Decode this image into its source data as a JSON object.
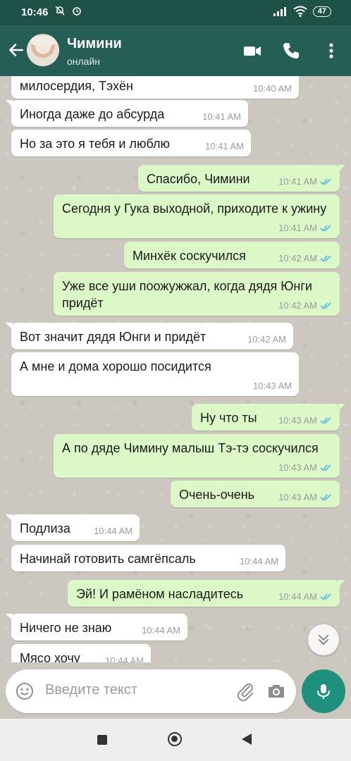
{
  "status_bar": {
    "time": "10:46",
    "battery": "47"
  },
  "header": {
    "contact_name": "Чимини",
    "contact_status": "онлайн"
  },
  "messages": [
    {
      "dir": "in",
      "text": "милосердия, Тэхён",
      "time": "10:40 AM"
    },
    {
      "dir": "in",
      "text": "Иногда даже до абсурда",
      "time": "10:41 AM"
    },
    {
      "dir": "in",
      "text": "Но за это я тебя и люблю",
      "time": "10:41 AM"
    },
    {
      "dir": "out",
      "text": "Спасибо, Чимини",
      "time": "10:41 AM"
    },
    {
      "dir": "out",
      "text": "Сегодня у Гука выходной, приходите к ужину",
      "time": "10:41 AM"
    },
    {
      "dir": "out",
      "text": "Минхёк соскучился",
      "time": "10:42 AM"
    },
    {
      "dir": "out",
      "text": "Уже все уши поожужжал, когда дядя Юнги придёт",
      "time": "10:42 AM"
    },
    {
      "dir": "in",
      "text": "Вот значит дядя Юнги и придёт",
      "time": "10:42 AM"
    },
    {
      "dir": "in",
      "text": "А мне и дома хорошо посидится",
      "time": "10:43 AM"
    },
    {
      "dir": "out",
      "text": "Ну что ты",
      "time": "10:43 AM"
    },
    {
      "dir": "out",
      "text": "А по дяде Чимину малыш Тэ-тэ соскучился",
      "time": "10:43 AM"
    },
    {
      "dir": "out",
      "text": "Очень-очень",
      "time": "10:43 AM"
    },
    {
      "dir": "in",
      "text": "Подлиза",
      "time": "10:44 AM"
    },
    {
      "dir": "in",
      "text": "Начинай готовить самгёпсаль",
      "time": "10:44 AM"
    },
    {
      "dir": "out",
      "text": "Эй! И рамёном насладитесь",
      "time": "10:44 AM"
    },
    {
      "dir": "in",
      "text": "Ничего не знаю",
      "time": "10:44 AM"
    },
    {
      "dir": "in",
      "text": "Мясо хочу",
      "time": "10:44 AM"
    }
  ],
  "composer": {
    "placeholder": "Введите текст"
  },
  "colors": {
    "header": "#245e54",
    "outgoing": "#dcf8c6",
    "incoming": "#ffffff",
    "mic": "#1f8f7e",
    "read_ticks": "#4fb6ec"
  }
}
